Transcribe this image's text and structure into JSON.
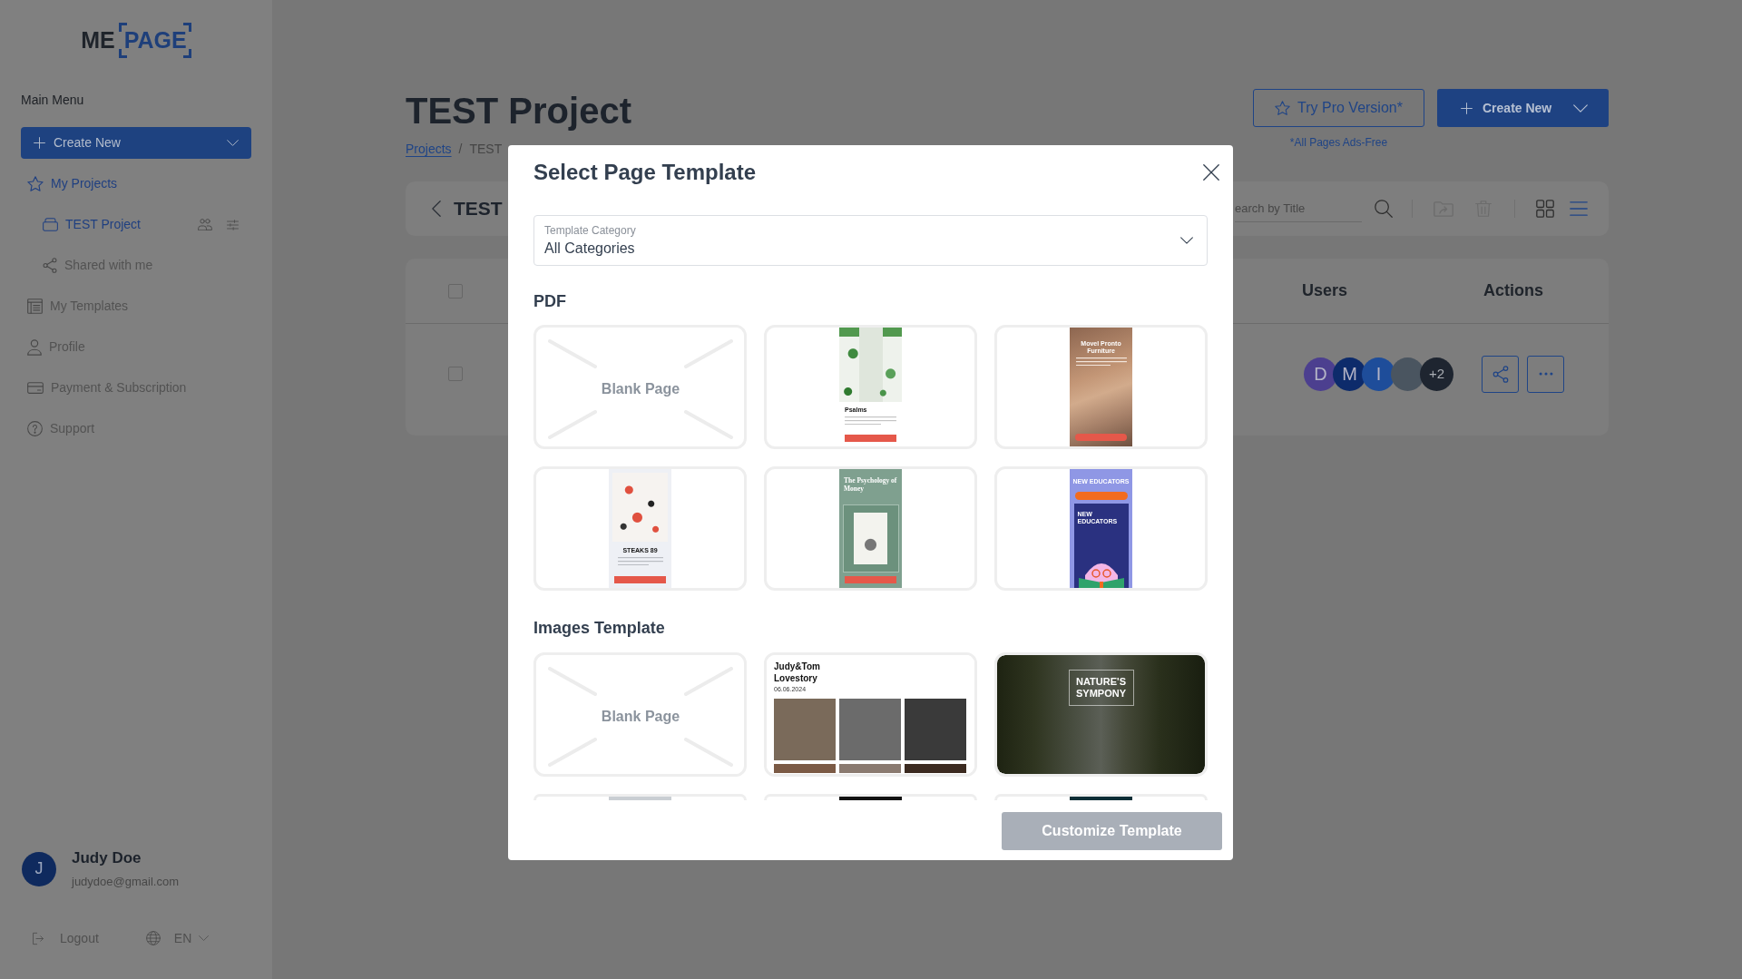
{
  "sidebar": {
    "logo": {
      "prefix": "ME",
      "framed": "PAGE"
    },
    "menu_title": "Main Menu",
    "create_button": {
      "label": "Create New"
    },
    "items": [
      {
        "label": "My Projects",
        "selected": true,
        "children": [
          {
            "kind": "project",
            "label": "TEST Project",
            "selected": true
          },
          {
            "kind": "link",
            "label": "Shared with me",
            "selected": false
          }
        ]
      },
      {
        "label": "My Templates",
        "selected": false
      },
      {
        "label": "Profile",
        "selected": false
      },
      {
        "label": "Payment & Subscription",
        "selected": false
      },
      {
        "label": "Support",
        "selected": false
      }
    ],
    "user": {
      "initial": "J",
      "name": "Judy Doe",
      "email": "judydoe@gmail.com"
    },
    "logout": "Logout",
    "language": "EN"
  },
  "header": {
    "title": "TEST Project",
    "breadcrumb": [
      {
        "kind": "link",
        "label": "Projects"
      },
      {
        "kind": "current",
        "label": "TEST"
      }
    ],
    "separator": "/",
    "pro_button": "Try Pro Version*",
    "pro_note": "*All Pages Ads-Free",
    "create_button": "Create New"
  },
  "toolbar": {
    "title": "TEST",
    "search": {
      "placeholder": "earch by Title"
    },
    "actions": [
      {
        "disabled": true
      },
      {
        "disabled": true
      }
    ],
    "views": [
      {
        "selected": false
      },
      {
        "selected": true
      }
    ]
  },
  "table": {
    "select_all": {
      "checked": false
    },
    "columns": [
      "Users",
      "Actions"
    ],
    "rows": [
      {
        "checked": false,
        "users": [
          {
            "kind": "initial",
            "label": "D",
            "color": "#4c3f8f"
          },
          {
            "kind": "initial",
            "label": "M",
            "color": "#0d2b6b"
          },
          {
            "kind": "initial",
            "label": "I",
            "color": "#1e4d9a"
          },
          {
            "kind": "photo"
          },
          {
            "kind": "count",
            "label": "+2"
          }
        ]
      }
    ]
  },
  "modal": {
    "title": "Select Page Template",
    "category": {
      "label": "Template Category",
      "value": "All Categories"
    },
    "sections": [
      {
        "title": "PDF",
        "templates": [
          {
            "kind": "blank",
            "label": "Blank Page",
            "selected": false
          },
          {
            "kind": "leafy",
            "title": "Psalms",
            "selected": false
          },
          {
            "kind": "photo-cover",
            "title": "Movel Pronto Furniture",
            "selected": false
          },
          {
            "kind": "poster",
            "title": "STEAKS 89",
            "selected": false
          },
          {
            "kind": "book",
            "title": "The Psychology of Money",
            "selected": false
          },
          {
            "kind": "illustrated",
            "title": "NEW EDUCATORS",
            "cover_title": "NEW EDUCATORS",
            "selected": false
          }
        ]
      },
      {
        "title": "Images Template",
        "templates": [
          {
            "kind": "blank",
            "label": "Blank Page",
            "selected": false
          },
          {
            "kind": "collage",
            "title": "Judy&Tom Lovestory",
            "date": "06.06.2024",
            "selected": false
          },
          {
            "kind": "landscape",
            "title": "NATURE'S SYMPONY",
            "selected": false
          },
          {
            "kind": "partial",
            "selected": false
          },
          {
            "kind": "partial",
            "selected": false
          },
          {
            "kind": "partial",
            "selected": false
          }
        ]
      }
    ],
    "button": {
      "label": "Customize Template",
      "disabled": true
    }
  }
}
